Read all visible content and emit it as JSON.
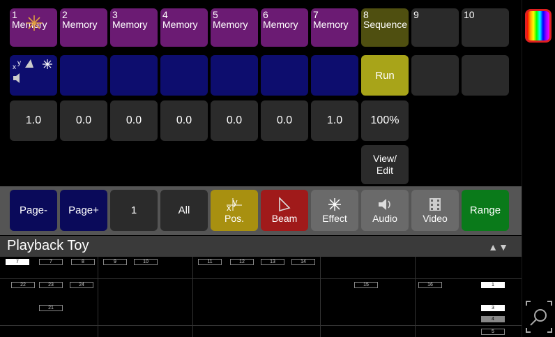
{
  "playbacks": [
    {
      "num": "1",
      "label": "Memory"
    },
    {
      "num": "2",
      "label": "Memory"
    },
    {
      "num": "3",
      "label": "Memory"
    },
    {
      "num": "4",
      "label": "Memory"
    },
    {
      "num": "5",
      "label": "Memory"
    },
    {
      "num": "6",
      "label": "Memory"
    },
    {
      "num": "7",
      "label": "Memory"
    },
    {
      "num": "8",
      "label": "Sequence"
    },
    {
      "num": "9",
      "label": ""
    },
    {
      "num": "10",
      "label": ""
    }
  ],
  "row2": {
    "run_label": "Run"
  },
  "levels": [
    "1.0",
    "0.0",
    "0.0",
    "0.0",
    "0.0",
    "0.0",
    "1.0",
    "100%"
  ],
  "view_edit_label": "View/\nEdit",
  "toolbar": {
    "page_minus": "Page-",
    "page_plus": "Page+",
    "page_number": "1",
    "all": "All",
    "pos": "Pos.",
    "beam": "Beam",
    "effect": "Effect",
    "audio": "Audio",
    "video": "Video",
    "range": "Range"
  },
  "playback_toy": {
    "title": "Playback Toy",
    "arrows": "▲▼",
    "tags_row1": [
      "7",
      "7",
      "8",
      "9",
      "10",
      "11",
      "12",
      "13",
      "14"
    ],
    "tags_row2": [
      "22",
      "23",
      "24",
      "15",
      "16",
      "1"
    ],
    "tags_row3": [
      "21",
      "3",
      "4",
      "5"
    ]
  },
  "colors": {
    "memory": "#6b1b73",
    "sequence": "#4f4f10",
    "run": "#a8a419",
    "range": "#0a7a1a",
    "beam": "#a01a1a",
    "pos": "#a89010"
  },
  "icons": {
    "rainbow": "color-palette-icon",
    "zoom": "zoom-icon"
  }
}
